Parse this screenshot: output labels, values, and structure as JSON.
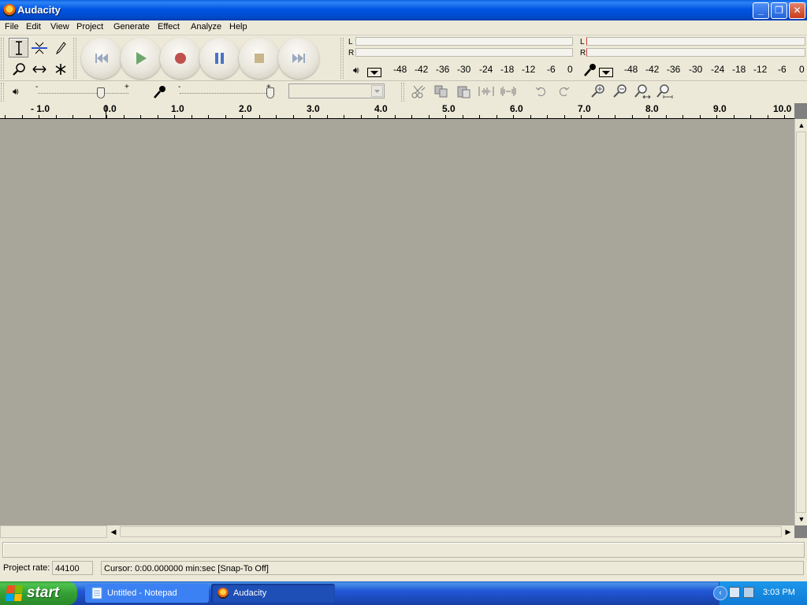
{
  "window": {
    "title": "Audacity",
    "controls": {
      "minimize": "_",
      "restore": "❐",
      "close": "✕"
    }
  },
  "menu": [
    "File",
    "Edit",
    "View",
    "Project",
    "Generate",
    "Effect",
    "Analyze",
    "Help"
  ],
  "meters": {
    "playback": {
      "left_label": "L",
      "right_label": "R"
    },
    "record": {
      "left_label": "L",
      "right_label": "R"
    },
    "scale": [
      "-48",
      "-42",
      "-36",
      "-30",
      "-24",
      "-18",
      "-12",
      "-6",
      "0"
    ]
  },
  "mixer": {
    "minus": "-",
    "plus": "+",
    "input_device": ""
  },
  "ruler": {
    "labels": [
      "- 1.0",
      "0.0",
      "1.0",
      "2.0",
      "3.0",
      "4.0",
      "5.0",
      "6.0",
      "7.0",
      "8.0",
      "9.0",
      "10.0"
    ]
  },
  "status": {
    "project_rate_label": "Project rate:",
    "project_rate_value": "44100",
    "cursor_text": "Cursor: 0:00.000000 min:sec   [Snap-To Off]"
  },
  "taskbar": {
    "start_label": "start",
    "tasks": [
      {
        "label": "Untitled - Notepad"
      },
      {
        "label": "Audacity"
      }
    ],
    "clock": "3:03 PM"
  },
  "colors": {
    "title_blue": "#0054e3",
    "track_bg": "#a8a59a",
    "record_red": "#c0504d",
    "play_green": "#5aa05a",
    "taskbar_blue": "#245edc"
  }
}
